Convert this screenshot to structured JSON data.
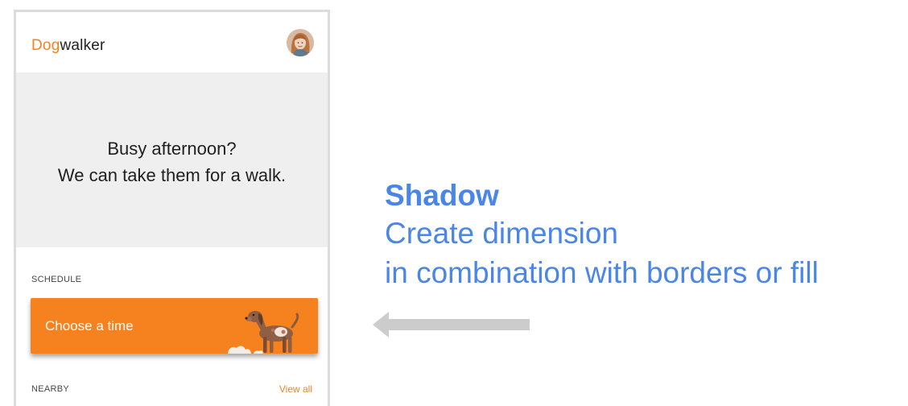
{
  "app": {
    "logo_accent": "Dog",
    "logo_rest": "walker"
  },
  "hero": {
    "line1": "Busy afternoon?",
    "line2": "We can take them for a walk."
  },
  "schedule": {
    "label": "SCHEDULE",
    "cta_label": "Choose a time"
  },
  "nearby": {
    "label": "NEARBY",
    "view_all": "View all"
  },
  "caption": {
    "title": "Shadow",
    "line1": "Create dimension",
    "line2": "in combination with borders or fill"
  },
  "colors": {
    "accent": "#f5821f",
    "caption": "#4a86e8",
    "hero_bg": "#efefef",
    "arrow": "#cccccc"
  },
  "icons": {
    "avatar": "user-avatar-photo",
    "illustration": "dog-illustration",
    "arrow": "left-arrow-icon"
  }
}
